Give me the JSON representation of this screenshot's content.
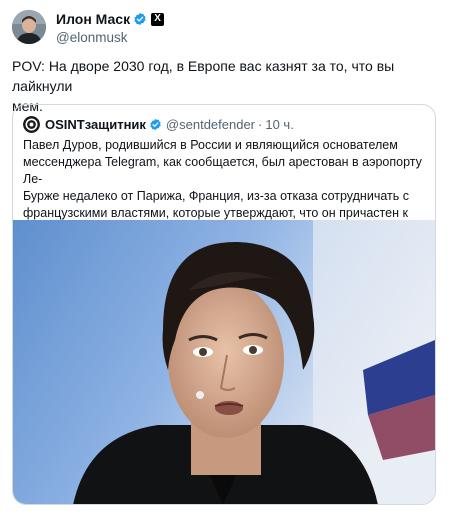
{
  "post": {
    "author_name": "Илон Маск",
    "handle": "@elonmusk",
    "text": "POV: На дворе 2030 год, в Европе вас казнят за то, что вы лайкнули\nмем."
  },
  "quoted_post": {
    "author_name": "OSINTзащитник",
    "handle": "@sentdefender",
    "separator": "·",
    "time": "10 ч.",
    "text": "Павел Дуров, родившийся в России и являющийся основателем\nмессенджера Telegram, как сообщается, был арестован в аэропорту Ле-\nБурже недалеко от Парижа, Франция, из-за отказа сотрудничать с\nфранцузскими властями, которые утверждают, что он причастен к\nнезаконному обороту наркотиков и другим тяжким преступлениям."
  },
  "badges": {
    "verified_color": "#1d9bf0",
    "affiliate_badge": "X"
  },
  "icons": {
    "verified": "verified-checkmark-icon",
    "affiliate": "x-logo-icon"
  },
  "colors": {
    "text": "#0f1419",
    "secondary": "#536471",
    "border": "#cfd9de"
  }
}
